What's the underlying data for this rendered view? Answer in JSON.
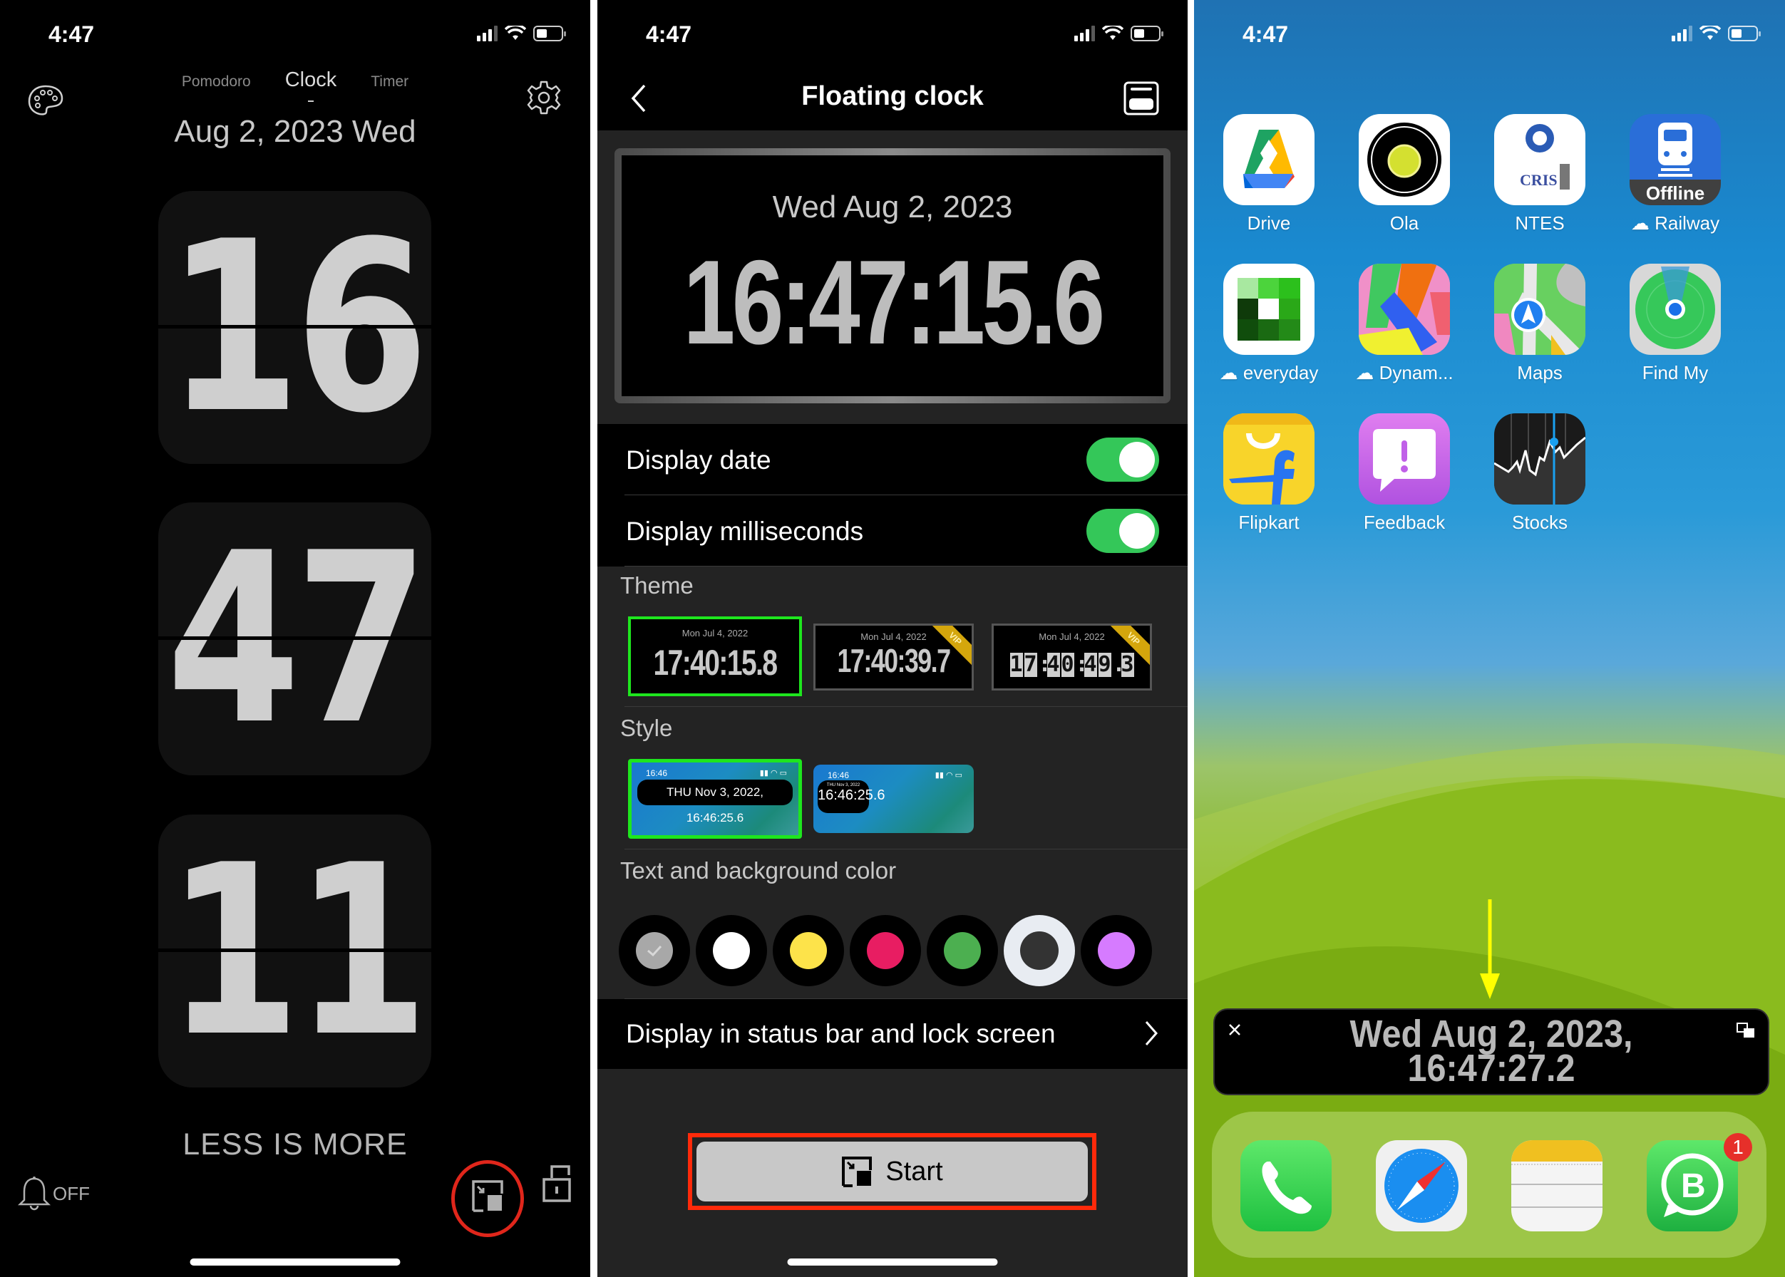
{
  "status_bar": {
    "time": "4:47"
  },
  "panel1": {
    "tabs": [
      {
        "label": "Pomodoro",
        "active": false
      },
      {
        "label": "Clock",
        "active": true
      },
      {
        "label": "Timer",
        "active": false
      }
    ],
    "date": "Aug 2, 2023  Wed",
    "flip_hours": "16",
    "flip_minutes": "47",
    "flip_seconds": "11",
    "motto": "LESS IS MORE",
    "alarm_label": "OFF",
    "icons": {
      "palette": "palette-icon",
      "settings": "gear-icon",
      "bell": "bell-icon",
      "pip": "picture-in-picture-icon",
      "lock": "unlock-icon"
    },
    "highlight_color": "#e0261b"
  },
  "panel2": {
    "title": "Floating clock",
    "preview": {
      "date": "Wed  Aug 2, 2023",
      "time": "16:47:15.6"
    },
    "toggles": [
      {
        "label": "Display date",
        "on": true
      },
      {
        "label": "Display milliseconds",
        "on": true
      }
    ],
    "theme_label": "Theme",
    "themes": [
      {
        "date": "Mon  Jul 4, 2022",
        "time": "17:40:15.8",
        "vip": false,
        "selected": true
      },
      {
        "date": "Mon  Jul 4, 2022",
        "time": "17:40:39.7",
        "vip": true,
        "selected": false
      },
      {
        "date": "Mon  Jul 4, 2022",
        "time": "17:40:49.3",
        "vip": true,
        "selected": false
      }
    ],
    "vip_label": "VIP",
    "style_label": "Style",
    "styles": [
      {
        "status_time": "16:46",
        "text": "THU Nov 3, 2022, 16:46:25.6",
        "selected": true
      },
      {
        "status_time": "16:46",
        "date": "THU Nov 3, 2022",
        "time": "16:46:25.6",
        "selected": false
      }
    ],
    "color_label": "Text and background color",
    "colors": [
      {
        "name": "gray",
        "hex": "#a8a8a8",
        "checked": true,
        "selected": false
      },
      {
        "name": "white",
        "hex": "#ffffff",
        "checked": false,
        "selected": false
      },
      {
        "name": "yellow",
        "hex": "#fde34a",
        "checked": false,
        "selected": false
      },
      {
        "name": "pink",
        "hex": "#e81d62",
        "checked": false,
        "selected": false
      },
      {
        "name": "green",
        "hex": "#4caf50",
        "checked": false,
        "selected": false
      },
      {
        "name": "dark",
        "hex": "#333333",
        "checked": false,
        "selected": true
      },
      {
        "name": "violet",
        "hex": "#d67bff",
        "checked": false,
        "selected": false
      }
    ],
    "status_bar_row": "Display in status bar and lock screen",
    "start_label": "Start",
    "toggle_color": "#34c759",
    "selected_border": "#1ee61e"
  },
  "panel3": {
    "apps": [
      {
        "label": "Drive",
        "cloud": false
      },
      {
        "label": "Ola",
        "cloud": false
      },
      {
        "label": "NTES",
        "cloud": false
      },
      {
        "label": "Railway",
        "cloud": true,
        "icon_text": "Offline"
      },
      {
        "label": "everyday",
        "cloud": true
      },
      {
        "label": "Dynam...",
        "cloud": true
      },
      {
        "label": "Maps",
        "cloud": false
      },
      {
        "label": "Find My",
        "cloud": false
      },
      {
        "label": "Flipkart",
        "cloud": false
      },
      {
        "label": "Feedback",
        "cloud": false
      },
      {
        "label": "Stocks",
        "cloud": false
      }
    ],
    "ntes_icon_text": "CRIS",
    "floating_clock": {
      "line1": "Wed  Aug 2, 2023,",
      "line2": "16:47:27.2"
    },
    "dock": [
      {
        "name": "Phone"
      },
      {
        "name": "Safari"
      },
      {
        "name": "Notes"
      },
      {
        "name": "WhatsApp Business",
        "badge": "1"
      }
    ],
    "arrow_color": "#ffff00"
  }
}
